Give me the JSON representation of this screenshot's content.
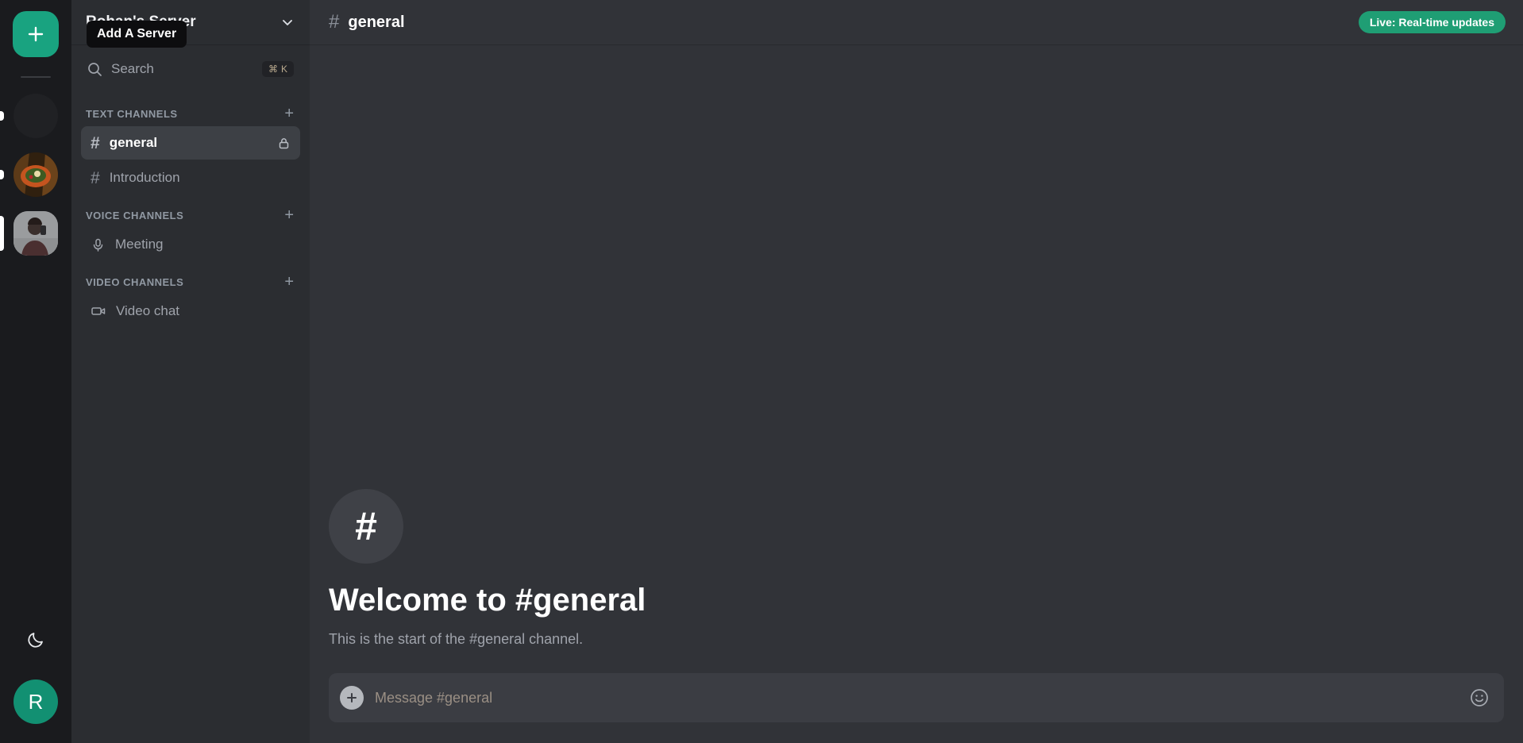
{
  "colors": {
    "accent_green": "#19a380",
    "badge_green": "#1f9e74",
    "avatar_green": "#129072",
    "rail_bg": "#1a1b1e",
    "sidebar_bg": "#2b2d31",
    "main_bg": "#313338",
    "active_channel_bg": "#3d4045",
    "composer_bg": "#3b3d43"
  },
  "rail": {
    "add_server_label": "+",
    "add_server_icon": "plus-icon",
    "servers": [
      {
        "name": "server-icon-dark",
        "label": "",
        "selected": false,
        "indicator": "small"
      },
      {
        "name": "server-icon-food",
        "label": "",
        "selected": false,
        "indicator": "small"
      },
      {
        "name": "server-icon-rohan",
        "label": "",
        "selected": true,
        "indicator": "large"
      }
    ],
    "theme_toggle_icon": "moon-icon",
    "user_avatar_initial": "R"
  },
  "tooltip": {
    "text": "Add A Server"
  },
  "sidebar": {
    "server_name": "Rohan's Server",
    "server_chevron_icon": "chevron-down-icon",
    "search": {
      "placeholder": "Search",
      "icon": "search-icon",
      "shortcut_symbol": "⌘",
      "shortcut_key": "K"
    },
    "categories": [
      {
        "label": "TEXT CHANNELS",
        "add_icon": "plus-icon",
        "channels": [
          {
            "name": "general",
            "icon": "hash-icon",
            "active": true,
            "badge_icon": "lock-icon"
          },
          {
            "name": "Introduction",
            "icon": "hash-icon",
            "active": false,
            "badge_icon": ""
          }
        ]
      },
      {
        "label": "VOICE CHANNELS",
        "add_icon": "plus-icon",
        "channels": [
          {
            "name": "Meeting",
            "icon": "microphone-icon",
            "active": false,
            "badge_icon": ""
          }
        ]
      },
      {
        "label": "VIDEO CHANNELS",
        "add_icon": "plus-icon",
        "channels": [
          {
            "name": "Video chat",
            "icon": "video-camera-icon",
            "active": false,
            "badge_icon": ""
          }
        ]
      }
    ]
  },
  "main": {
    "header": {
      "hash": "#",
      "channel_title": "general",
      "live_badge": "Live: Real-time updates"
    },
    "welcome": {
      "icon_glyph": "#",
      "title": "Welcome to #general",
      "subtitle": "This is the start of the #general channel."
    },
    "composer": {
      "attach_icon": "plus-icon",
      "placeholder": "Message #general",
      "emoji_icon": "smiley-icon"
    }
  }
}
